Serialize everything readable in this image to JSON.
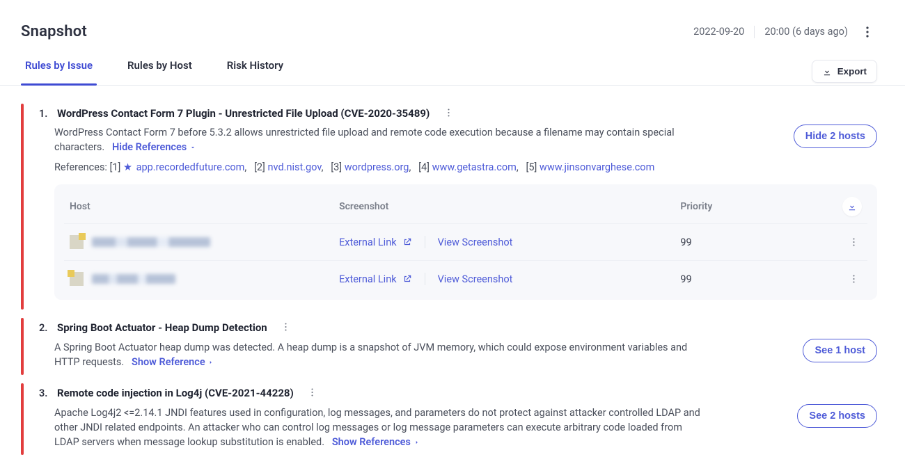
{
  "header": {
    "title": "Snapshot",
    "date": "2022-09-20",
    "time": "20:00",
    "relative": "(6 days ago)"
  },
  "tabs": {
    "items": [
      "Rules by Issue",
      "Rules by Host",
      "Risk History"
    ],
    "active_index": 0,
    "export_label": "Export"
  },
  "hosts_table": {
    "headers": {
      "host": "Host",
      "screenshot": "Screenshot",
      "priority": "Priority"
    },
    "external_link_label": "External Link",
    "view_screenshot_label": "View Screenshot"
  },
  "issues": [
    {
      "num": "1.",
      "title": "WordPress Contact Form 7 Plugin - Unrestricted File Upload (CVE-2020-35489)",
      "description": "WordPress Contact Form 7 before 5.3.2 allows unrestricted file upload and remote code execution because a filename may contain special characters.",
      "ref_toggle_label": "Hide References",
      "references_prefix": "References:",
      "references": [
        {
          "idx": "[1]",
          "starred": true,
          "text": "app.recordedfuture.com"
        },
        {
          "idx": "[2]",
          "starred": false,
          "text": "nvd.nist.gov"
        },
        {
          "idx": "[3]",
          "starred": false,
          "text": "wordpress.org"
        },
        {
          "idx": "[4]",
          "starred": false,
          "text": "www.getastra.com"
        },
        {
          "idx": "[5]",
          "starred": false,
          "text": "www.jinsonvarghese.com"
        }
      ],
      "host_button_label": "Hide 2 hosts",
      "hosts": [
        {
          "priority": "99"
        },
        {
          "priority": "99"
        }
      ]
    },
    {
      "num": "2.",
      "title": "Spring Boot Actuator - Heap Dump Detection",
      "description": "A Spring Boot Actuator heap dump was detected. A heap dump is a snapshot of JVM memory, which could expose environment variables and HTTP requests.",
      "ref_toggle_label": "Show Reference",
      "host_button_label": "See 1 host"
    },
    {
      "num": "3.",
      "title": "Remote code injection in Log4j (CVE-2021-44228)",
      "description": "Apache Log4j2 <=2.14.1 JNDI features used in configuration, log messages, and parameters do not protect against attacker controlled LDAP and other JNDI related endpoints. An attacker who can control log messages or log message parameters can execute arbitrary code loaded from LDAP servers when message lookup substitution is enabled.",
      "ref_toggle_label": "Show References",
      "host_button_label": "See 2 hosts"
    }
  ]
}
